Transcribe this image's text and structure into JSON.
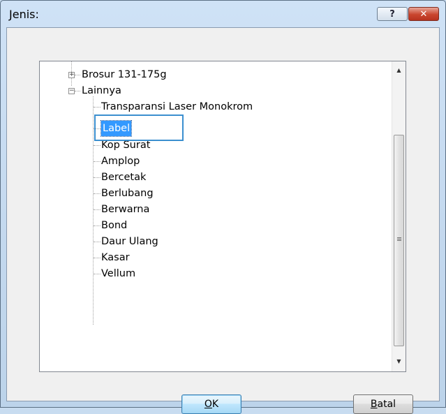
{
  "dialog": {
    "title": "Jenis:",
    "help_label": "?",
    "close_label": "✕"
  },
  "tree": {
    "items": [
      {
        "label": "Brosur 131-175g",
        "expander": "+"
      },
      {
        "label": "Lainnya",
        "expander": "−"
      },
      {
        "label": "Transparansi Laser Monokrom"
      },
      {
        "label": "Label",
        "selected": true
      },
      {
        "label": "Kop Surat"
      },
      {
        "label": "Amplop"
      },
      {
        "label": "Bercetak"
      },
      {
        "label": "Berlubang"
      },
      {
        "label": "Berwarna"
      },
      {
        "label": "Bond"
      },
      {
        "label": "Daur Ulang"
      },
      {
        "label": "Kasar"
      },
      {
        "label": "Vellum"
      }
    ]
  },
  "buttons": {
    "ok": {
      "mnemonic": "O",
      "rest": "K"
    },
    "cancel": {
      "mnemonic": "B",
      "rest": "atal"
    }
  },
  "colors": {
    "selection": "#3399ff",
    "focus_frame": "#3b8fcf",
    "close_button": "#c9452e"
  }
}
